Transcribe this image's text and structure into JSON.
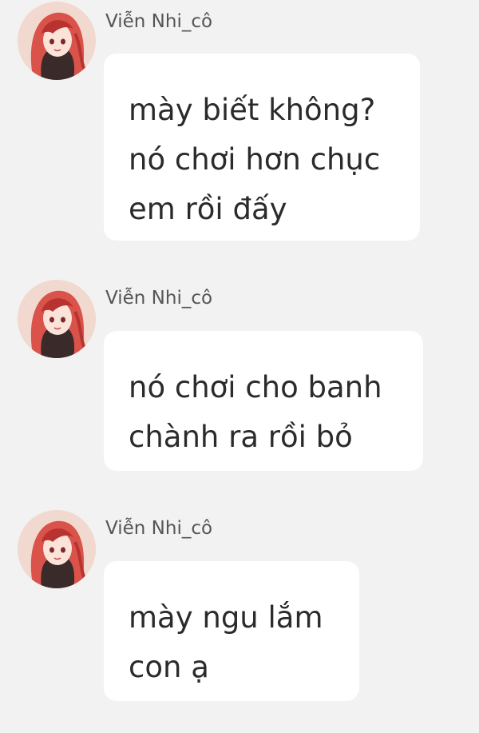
{
  "messages": [
    {
      "sender": "Viễn Nhi_cô",
      "lines": [
        "mày biết không?",
        "nó chơi hơn chục",
        "em rồi đấy"
      ]
    },
    {
      "sender": "Viễn Nhi_cô",
      "lines": [
        "nó chơi cho banh",
        "chành ra rồi bỏ"
      ]
    },
    {
      "sender": "Viễn Nhi_cô",
      "lines": [
        "mày ngu lắm",
        "con ạ"
      ]
    }
  ],
  "avatar": {
    "icon": "anime-girl-red-hair-avatar",
    "colors": {
      "background": "#f1d9cf",
      "hair": "#d9534a",
      "hair_dark": "#b8332f",
      "skin": "#fbe3da",
      "clothing": "#3a2a2a"
    }
  },
  "colors": {
    "page_background": "#f2f2f2",
    "bubble_background": "#ffffff",
    "message_text": "#2b2b2b",
    "sender_text": "#555555"
  }
}
